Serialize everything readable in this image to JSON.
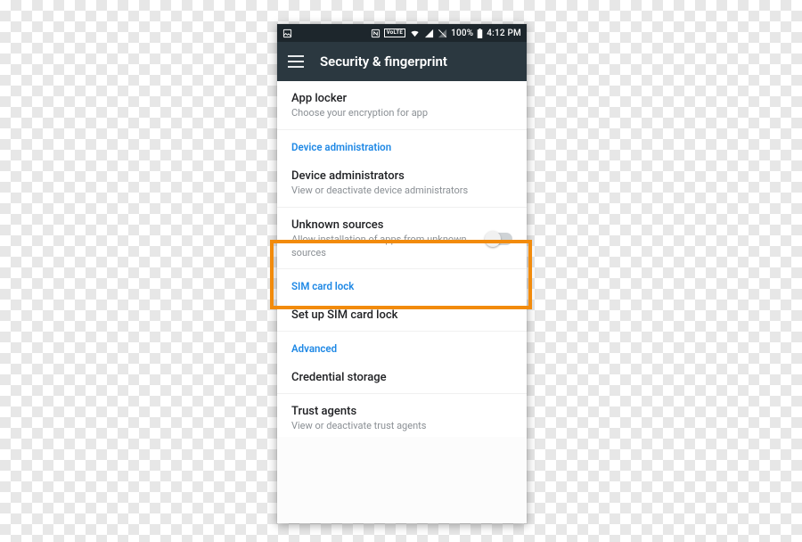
{
  "statusbar": {
    "nfc_label": "N",
    "volte_label": "VoLTE",
    "battery_pct": "100%",
    "clock": "4:12 PM"
  },
  "appbar": {
    "title": "Security & fingerprint"
  },
  "rows": {
    "app_locker": {
      "title": "App locker",
      "sub": "Choose your encryption for app"
    },
    "sect_device_admin": "Device administration",
    "device_admins": {
      "title": "Device administrators",
      "sub": "View or deactivate device administrators"
    },
    "unknown_sources": {
      "title": "Unknown sources",
      "sub": "Allow installation of apps from unknown sources",
      "enabled": false
    },
    "sect_sim_lock": "SIM card lock",
    "sim_setup": {
      "title": "Set up SIM card lock"
    },
    "sect_advanced": "Advanced",
    "cred_storage": {
      "title": "Credential storage"
    },
    "trust_agents": {
      "title": "Trust agents",
      "sub": "View or deactivate trust agents"
    }
  }
}
